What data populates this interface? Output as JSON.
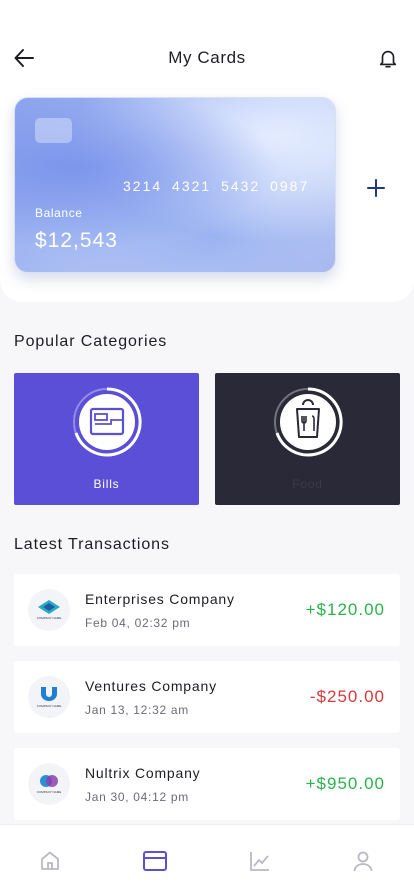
{
  "header": {
    "title": "My Cards",
    "back_icon": "arrow-left-icon",
    "bell_icon": "bell-icon"
  },
  "card": {
    "number": "3214 4321 5432 0987",
    "balance_label": "Balance",
    "balance_value": "$12,543"
  },
  "add_card_icon": "plus-icon",
  "categories": {
    "title": "Popular Categories",
    "items": [
      {
        "label": "Bills",
        "icon": "wallet-icon",
        "color": "#5a4fd6"
      },
      {
        "label": "Food",
        "icon": "food-bag-icon",
        "color": "#2a2938"
      }
    ]
  },
  "transactions": {
    "title": "Latest Transactions",
    "items": [
      {
        "name": "Enterprises Company",
        "date": "Feb 04, 02:32 pm",
        "amount": "+$120.00",
        "logo_text": "COMPANY NAME",
        "type": "positive"
      },
      {
        "name": "Ventures Company",
        "date": "Jan 13, 12:32 am",
        "amount": "-$250.00",
        "logo_text": "COMPANY NAME",
        "type": "negative"
      },
      {
        "name": "Nultrix Company",
        "date": "Jan 30, 04:12 pm",
        "amount": "+$950.00",
        "logo_text": "COMPANY NAME",
        "type": "positive"
      }
    ]
  },
  "bottom_nav": {
    "items": [
      {
        "icon": "home-icon",
        "active": false
      },
      {
        "icon": "card-icon",
        "active": true
      },
      {
        "icon": "chart-icon",
        "active": false
      },
      {
        "icon": "profile-icon",
        "active": false
      }
    ],
    "active_color": "#5a4fd6",
    "inactive_color": "#b9b9c4"
  },
  "colors": {
    "positive": "#2bb24a",
    "negative": "#d53a3a",
    "accent": "#5a4fd6"
  }
}
